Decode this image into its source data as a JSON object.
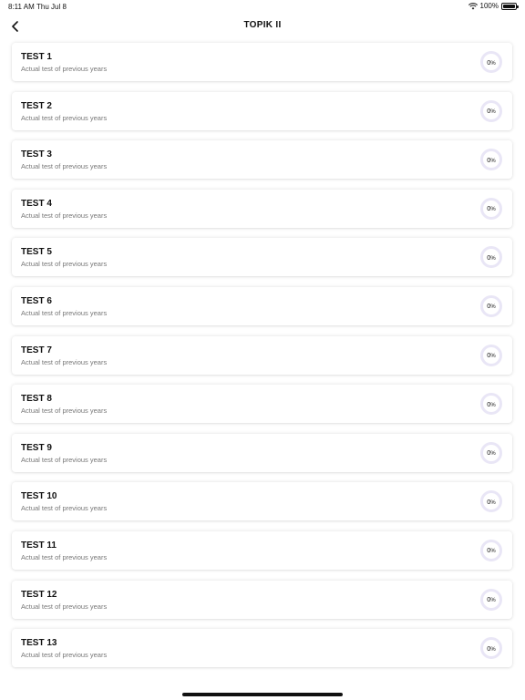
{
  "status_bar": {
    "time": "8:11 AM",
    "date": "Thu Jul 8",
    "battery": "100%"
  },
  "nav": {
    "title": "TOPIK II"
  },
  "tests": [
    {
      "title": "TEST 1",
      "subtitle": "Actual test of previous years",
      "progress": "0"
    },
    {
      "title": "TEST 2",
      "subtitle": "Actual test of previous years",
      "progress": "0"
    },
    {
      "title": "TEST 3",
      "subtitle": "Actual test of previous years",
      "progress": "0"
    },
    {
      "title": "TEST 4",
      "subtitle": "Actual test of previous years",
      "progress": "0"
    },
    {
      "title": "TEST 5",
      "subtitle": "Actual test of previous years",
      "progress": "0"
    },
    {
      "title": "TEST 6",
      "subtitle": "Actual test of previous years",
      "progress": "0"
    },
    {
      "title": "TEST 7",
      "subtitle": "Actual test of previous years",
      "progress": "0"
    },
    {
      "title": "TEST 8",
      "subtitle": "Actual test of previous years",
      "progress": "0"
    },
    {
      "title": "TEST 9",
      "subtitle": "Actual test of previous years",
      "progress": "0"
    },
    {
      "title": "TEST 10",
      "subtitle": "Actual test of previous years",
      "progress": "0"
    },
    {
      "title": "TEST 11",
      "subtitle": "Actual test of previous years",
      "progress": "0"
    },
    {
      "title": "TEST 12",
      "subtitle": "Actual test of previous years",
      "progress": "0"
    },
    {
      "title": "TEST 13",
      "subtitle": "Actual test of previous years",
      "progress": "0"
    }
  ],
  "percent_symbol": "%",
  "icons": {
    "back": "chevron-left-icon",
    "wifi": "wifi-icon",
    "battery": "battery-icon"
  },
  "colors": {
    "progress_ring": "#e9e6f6"
  }
}
